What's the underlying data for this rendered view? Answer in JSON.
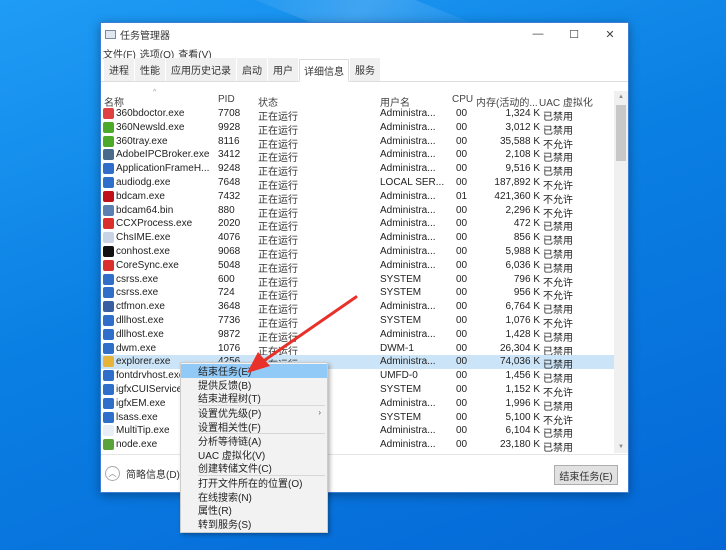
{
  "window": {
    "title": "任务管理器",
    "controls": {
      "minimize": "—",
      "maximize": "☐",
      "close": "✕"
    }
  },
  "menubar": [
    "文件(F)",
    "选项(O)",
    "查看(V)"
  ],
  "tabs": [
    {
      "label": "进程",
      "active": false
    },
    {
      "label": "性能",
      "active": false
    },
    {
      "label": "应用历史记录",
      "active": false
    },
    {
      "label": "启动",
      "active": false
    },
    {
      "label": "用户",
      "active": false
    },
    {
      "label": "详细信息",
      "active": true
    },
    {
      "label": "服务",
      "active": false
    }
  ],
  "columns": {
    "name": "名称",
    "pid": "PID",
    "status": "状态",
    "user": "用户名",
    "cpu": "CPU",
    "mem": "内存(活动的...",
    "uac": "UAC 虚拟化"
  },
  "rows": [
    {
      "icon": "360-doctor-icon",
      "color": "#e04040",
      "name": "360bdoctor.exe",
      "pid": "7708",
      "status": "正在运行",
      "user": "Administra...",
      "cpu": "00",
      "mem": "1,324 K",
      "uac": "已禁用"
    },
    {
      "icon": "360-news-icon",
      "color": "#4caa2a",
      "name": "360Newsld.exe",
      "pid": "9928",
      "status": "正在运行",
      "user": "Administra...",
      "cpu": "00",
      "mem": "3,012 K",
      "uac": "已禁用"
    },
    {
      "icon": "360-tray-icon",
      "color": "#4caa2a",
      "name": "360tray.exe",
      "pid": "8116",
      "status": "正在运行",
      "user": "Administra...",
      "cpu": "00",
      "mem": "35,588 K",
      "uac": "不允许"
    },
    {
      "icon": "adobe-ipc-icon",
      "color": "#4a6a8a",
      "name": "AdobeIPCBroker.exe",
      "pid": "3412",
      "status": "正在运行",
      "user": "Administra...",
      "cpu": "00",
      "mem": "2,108 K",
      "uac": "已禁用"
    },
    {
      "icon": "app-frame-icon",
      "color": "#2f6ec9",
      "name": "ApplicationFrameH...",
      "pid": "9248",
      "status": "正在运行",
      "user": "Administra...",
      "cpu": "00",
      "mem": "9,516 K",
      "uac": "已禁用"
    },
    {
      "icon": "audiodg-icon",
      "color": "#2f6ec9",
      "name": "audiodg.exe",
      "pid": "7648",
      "status": "正在运行",
      "user": "LOCAL SER...",
      "cpu": "00",
      "mem": "187,892 K",
      "uac": "不允许"
    },
    {
      "icon": "bdcam-icon",
      "color": "#c0101a",
      "name": "bdcam.exe",
      "pid": "7432",
      "status": "正在运行",
      "user": "Administra...",
      "cpu": "01",
      "mem": "421,360 K",
      "uac": "不允许"
    },
    {
      "icon": "bdcam64-icon",
      "color": "#5a7fb0",
      "name": "bdcam64.bin",
      "pid": "880",
      "status": "正在运行",
      "user": "Administra...",
      "cpu": "00",
      "mem": "2,296 K",
      "uac": "不允许"
    },
    {
      "icon": "ccx-process-icon",
      "color": "#d9302b",
      "name": "CCXProcess.exe",
      "pid": "2020",
      "status": "正在运行",
      "user": "Administra...",
      "cpu": "00",
      "mem": "472 K",
      "uac": "已禁用"
    },
    {
      "icon": "chsime-icon",
      "color": "#c9d3e6",
      "name": "ChsIME.exe",
      "pid": "4076",
      "status": "正在运行",
      "user": "Administra...",
      "cpu": "00",
      "mem": "856 K",
      "uac": "已禁用"
    },
    {
      "icon": "conhost-icon",
      "color": "#111111",
      "name": "conhost.exe",
      "pid": "9068",
      "status": "正在运行",
      "user": "Administra...",
      "cpu": "00",
      "mem": "5,988 K",
      "uac": "已禁用"
    },
    {
      "icon": "coresync-icon",
      "color": "#d9302b",
      "name": "CoreSync.exe",
      "pid": "5048",
      "status": "正在运行",
      "user": "Administra...",
      "cpu": "00",
      "mem": "6,036 K",
      "uac": "已禁用"
    },
    {
      "icon": "csrss-icon",
      "color": "#2f6ec9",
      "name": "csrss.exe",
      "pid": "600",
      "status": "正在运行",
      "user": "SYSTEM",
      "cpu": "00",
      "mem": "796 K",
      "uac": "不允许"
    },
    {
      "icon": "csrss-icon",
      "color": "#2f6ec9",
      "name": "csrss.exe",
      "pid": "724",
      "status": "正在运行",
      "user": "SYSTEM",
      "cpu": "00",
      "mem": "956 K",
      "uac": "不允许"
    },
    {
      "icon": "ctfmon-icon",
      "color": "#3a5fa0",
      "name": "ctfmon.exe",
      "pid": "3648",
      "status": "正在运行",
      "user": "Administra...",
      "cpu": "00",
      "mem": "6,764 K",
      "uac": "已禁用"
    },
    {
      "icon": "dllhost-icon",
      "color": "#2f6ec9",
      "name": "dllhost.exe",
      "pid": "7736",
      "status": "正在运行",
      "user": "SYSTEM",
      "cpu": "00",
      "mem": "1,076 K",
      "uac": "不允许"
    },
    {
      "icon": "dllhost-icon",
      "color": "#2f6ec9",
      "name": "dllhost.exe",
      "pid": "9872",
      "status": "正在运行",
      "user": "Administra...",
      "cpu": "00",
      "mem": "1,428 K",
      "uac": "已禁用"
    },
    {
      "icon": "dwm-icon",
      "color": "#2f6ec9",
      "name": "dwm.exe",
      "pid": "1076",
      "status": "正在运行",
      "user": "DWM-1",
      "cpu": "00",
      "mem": "26,304 K",
      "uac": "已禁用"
    },
    {
      "icon": "explorer-icon",
      "color": "#e8b33a",
      "name": "explorer.exe",
      "pid": "4256",
      "status": "正在运行",
      "user": "Administra...",
      "cpu": "00",
      "mem": "74,036 K",
      "uac": "已禁用",
      "selected": true
    },
    {
      "icon": "fontdrvhost-icon",
      "color": "#2f6ec9",
      "name": "fontdrvhost.exe",
      "pid": "",
      "status": "",
      "user": "UMFD-0",
      "cpu": "00",
      "mem": "1,456 K",
      "uac": "已禁用"
    },
    {
      "icon": "igfx-cui-icon",
      "color": "#2f6ec9",
      "name": "igfxCUIService",
      "pid": "",
      "status": "",
      "user": "SYSTEM",
      "cpu": "00",
      "mem": "1,152 K",
      "uac": "不允许"
    },
    {
      "icon": "igfx-em-icon",
      "color": "#2f6ec9",
      "name": "igfxEM.exe",
      "pid": "",
      "status": "",
      "user": "Administra...",
      "cpu": "00",
      "mem": "1,996 K",
      "uac": "已禁用"
    },
    {
      "icon": "lsass-icon",
      "color": "#2f6ec9",
      "name": "lsass.exe",
      "pid": "",
      "status": "",
      "user": "SYSTEM",
      "cpu": "00",
      "mem": "5,100 K",
      "uac": "不允许"
    },
    {
      "icon": "multitip-icon",
      "color": "#e8eef6",
      "name": "MultiTip.exe",
      "pid": "",
      "status": "",
      "user": "Administra...",
      "cpu": "00",
      "mem": "6,104 K",
      "uac": "已禁用"
    },
    {
      "icon": "node-icon",
      "color": "#5aa33a",
      "name": "node.exe",
      "pid": "",
      "status": "",
      "user": "Administra...",
      "cpu": "00",
      "mem": "23,180 K",
      "uac": "已禁用"
    }
  ],
  "footer": {
    "fewer_details": "简略信息(D)",
    "end_task": "结束任务(E)"
  },
  "context_menu": {
    "groups": [
      [
        {
          "label": "结束任务(E)",
          "highlight": true
        },
        {
          "label": "提供反馈(B)"
        },
        {
          "label": "结束进程树(T)"
        }
      ],
      [
        {
          "label": "设置优先级(P)",
          "submenu": true
        },
        {
          "label": "设置相关性(F)"
        }
      ],
      [
        {
          "label": "分析等待链(A)"
        },
        {
          "label": "UAC 虚拟化(V)"
        },
        {
          "label": "创建转储文件(C)"
        }
      ],
      [
        {
          "label": "打开文件所在的位置(O)"
        },
        {
          "label": "在线搜索(N)"
        },
        {
          "label": "属性(R)"
        },
        {
          "label": "转到服务(S)"
        }
      ]
    ]
  },
  "colors": {
    "accent": "#0a7fe3",
    "selection": "#cce4f7",
    "menu_highlight": "#91c9f7",
    "annotation_arrow": "#e8312a"
  }
}
